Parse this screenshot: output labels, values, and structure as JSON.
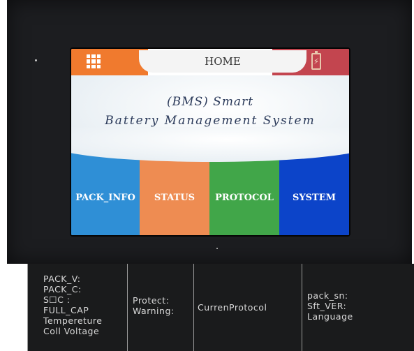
{
  "screen": {
    "header": {
      "title": "HOME",
      "menu_icon": "grid-menu-icon",
      "battery_icon": "battery-charging-icon"
    },
    "banner": {
      "line1": "(BMS) Smart",
      "line2": "Battery Management System"
    },
    "tiles": [
      {
        "label": "PACK_INFO",
        "color": "#2f8fd6"
      },
      {
        "label": "STATUS",
        "color": "#ee8c52"
      },
      {
        "label": "PROTOCOL",
        "color": "#41a649"
      },
      {
        "label": "SYSTEM",
        "color": "#0c44c9"
      }
    ]
  },
  "panel": {
    "col1": [
      "PACK_V:",
      "PACK_C:",
      "S☐C :",
      "FULL_CAP",
      "Tempereture",
      "Coll Voltage"
    ],
    "col2": [
      "Protect:",
      "Warning:"
    ],
    "col3": [
      "CurrenProtocol"
    ],
    "col4": [
      "pack_sn:",
      "Sft_VER:",
      "Language"
    ]
  }
}
